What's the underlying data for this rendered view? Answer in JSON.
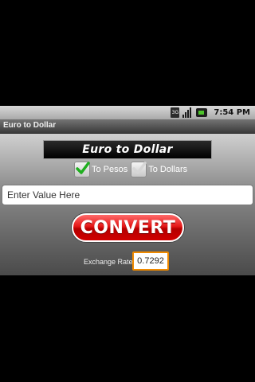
{
  "status_bar": {
    "network": "3G",
    "time": "7:54 PM",
    "icons": [
      "3g-icon",
      "signal-icon",
      "battery-icon"
    ]
  },
  "app": {
    "title": "Euro to Dollar"
  },
  "banner": {
    "text": "Euro to Dollar"
  },
  "options": [
    {
      "label": "To Pesos",
      "checked": true
    },
    {
      "label": "To Dollars",
      "checked": false
    }
  ],
  "input": {
    "placeholder": "Enter Value Here",
    "value": ""
  },
  "convert_button": {
    "label": "CONVERT"
  },
  "exchange": {
    "label": "Exchange Rate",
    "value": "0.7292"
  },
  "colors": {
    "convert": "#e51818",
    "rate_border": "#f08a00",
    "check": "#1fae1f"
  }
}
